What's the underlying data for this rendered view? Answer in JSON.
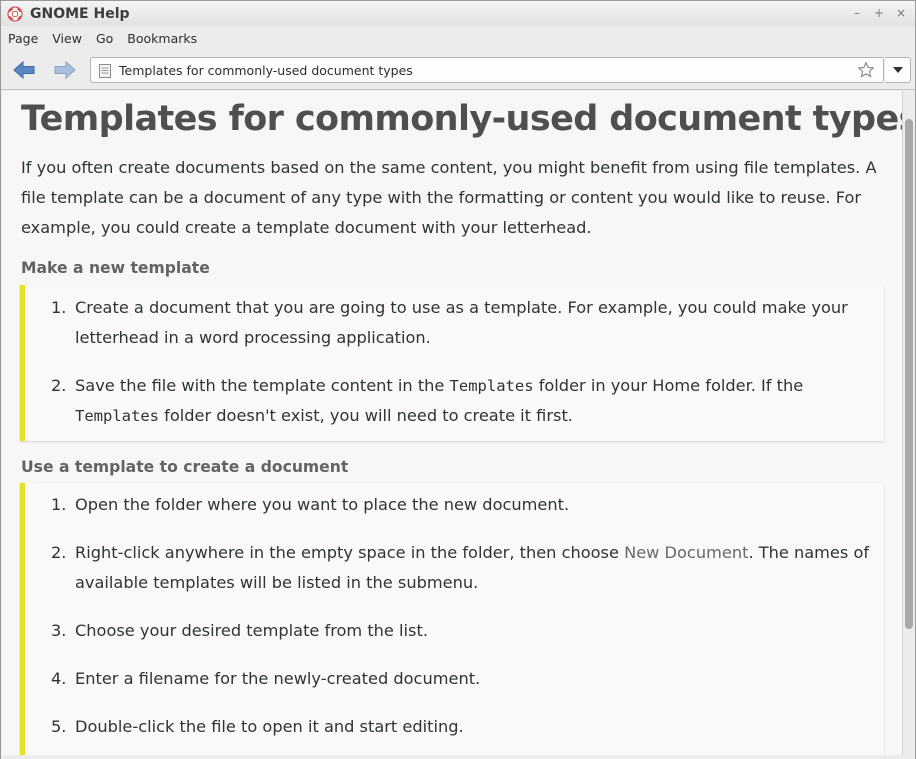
{
  "window": {
    "title": "GNOME Help"
  },
  "menubar": {
    "items": [
      "Page",
      "View",
      "Go",
      "Bookmarks"
    ]
  },
  "toolbar": {
    "location": "Templates for commonly-used document types"
  },
  "page": {
    "title": "Templates for commonly-used document types",
    "intro": "If you often create documents based on the same content, you might benefit from using file templates. A file template can be a document of any type with the formatting or content you would like to reuse. For example, you could create a template document with your letterhead.",
    "section1": {
      "title": "Make a new template",
      "steps": [
        {
          "num": "1.",
          "text": "Create a document that you are going to use as a template. For example, you could make your letterhead in a word processing application."
        },
        {
          "num": "2.",
          "a": "Save the file with the template content in the ",
          "code1": "Templates",
          "b": " folder in your ",
          "home": "Home",
          "c": " folder. If the ",
          "code2": "Templates",
          "d": " folder doesn't exist, you will need to create it first."
        }
      ]
    },
    "section2": {
      "title": "Use a template to create a document",
      "steps": [
        {
          "num": "1.",
          "text": "Open the folder where you want to place the new document."
        },
        {
          "num": "2.",
          "a": "Right-click anywhere in the empty space in the folder, then choose ",
          "link": "New Document",
          "b": ". The names of available templates will be listed in the submenu."
        },
        {
          "num": "3.",
          "text": "Choose your desired template from the list."
        },
        {
          "num": "4.",
          "text": "Enter a filename for the newly-created document."
        },
        {
          "num": "5.",
          "text": "Double-click the file to open it and start editing."
        }
      ]
    }
  },
  "colors": {
    "accent_bar": "#e5e12b",
    "title": "#4f4f4f",
    "nav_arrow": "#5b86c5"
  }
}
